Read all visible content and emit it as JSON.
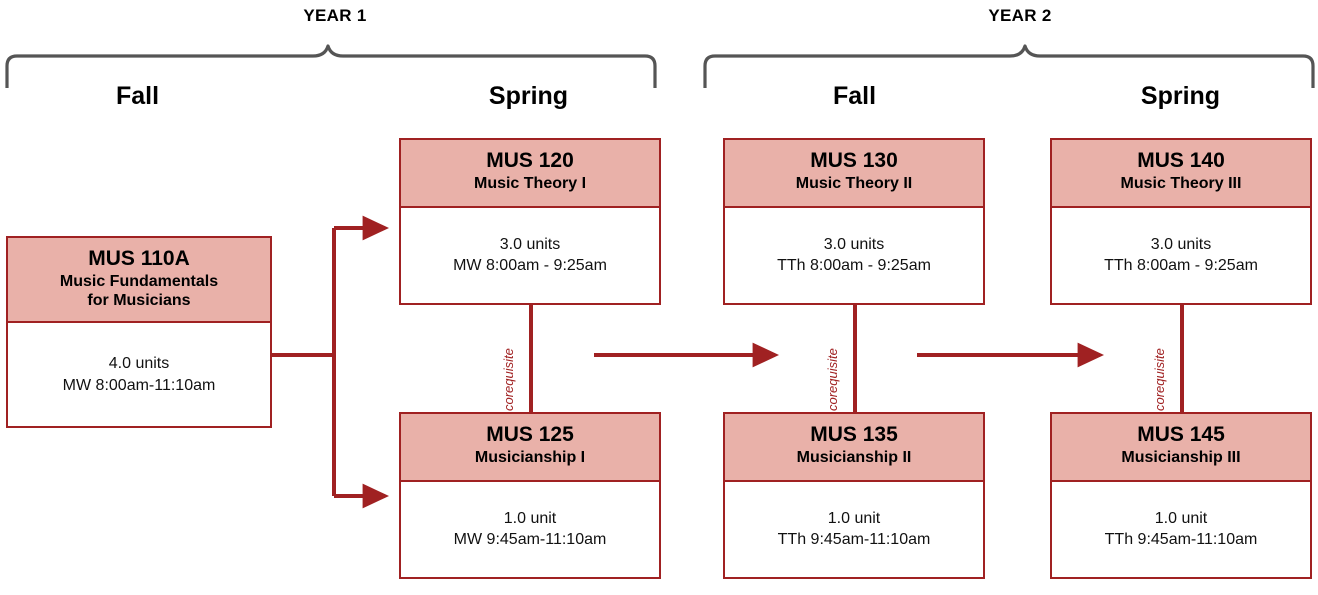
{
  "theme": {
    "box_fill": "#E9B1A9",
    "box_border": "#A02122",
    "arrow_color": "#A02122",
    "brace_color": "#555555",
    "text_color": "#000000",
    "background": "#FFFFFF"
  },
  "years": [
    {
      "label": "YEAR 1",
      "terms": [
        "Fall",
        "Spring"
      ]
    },
    {
      "label": "YEAR 2",
      "terms": [
        "Fall",
        "Spring"
      ]
    }
  ],
  "terms": [
    {
      "id": "y1-fall",
      "label": "Fall"
    },
    {
      "id": "y1-spring",
      "label": "Spring"
    },
    {
      "id": "y2-fall",
      "label": "Fall"
    },
    {
      "id": "y2-spring",
      "label": "Spring"
    }
  ],
  "courses": [
    {
      "id": "mus110a",
      "code": "MUS 110A",
      "title_line1": "Music Fundamentals",
      "title_line2": "for Musicians",
      "units": "4.0 units",
      "meeting": "MW 8:00am-11:10am"
    },
    {
      "id": "mus120",
      "code": "MUS 120",
      "title_line1": "Music Theory I",
      "title_line2": "",
      "units": "3.0 units",
      "meeting": "MW 8:00am - 9:25am"
    },
    {
      "id": "mus130",
      "code": "MUS 130",
      "title_line1": "Music Theory II",
      "title_line2": "",
      "units": "3.0 units",
      "meeting": "TTh 8:00am - 9:25am"
    },
    {
      "id": "mus140",
      "code": "MUS 140",
      "title_line1": "Music Theory III",
      "title_line2": "",
      "units": "3.0 units",
      "meeting": "TTh 8:00am - 9:25am"
    },
    {
      "id": "mus125",
      "code": "MUS 125",
      "title_line1": "Musicianship I",
      "title_line2": "",
      "units": "1.0 unit",
      "meeting": "MW 9:45am-11:10am"
    },
    {
      "id": "mus135",
      "code": "MUS 135",
      "title_line1": "Musicianship II",
      "title_line2": "",
      "units": "1.0 unit",
      "meeting": "TTh 9:45am-11:10am"
    },
    {
      "id": "mus145",
      "code": "MUS 145",
      "title_line1": "Musicianship III",
      "title_line2": "",
      "units": "1.0 unit",
      "meeting": "TTh 9:45am-11:10am"
    }
  ],
  "corequisite_links": [
    {
      "id": "coreq1",
      "label": "corequisite",
      "from": "mus120",
      "to": "mus125"
    },
    {
      "id": "coreq2",
      "label": "corequisite",
      "from": "mus130",
      "to": "mus135"
    },
    {
      "id": "coreq3",
      "label": "corequisite",
      "from": "mus140",
      "to": "mus145"
    }
  ],
  "prerequisite_flows": [
    {
      "from": "mus110a",
      "to": "mus120"
    },
    {
      "from": "mus110a",
      "to": "mus125"
    },
    {
      "from": "mus120",
      "to": "mus130"
    },
    {
      "from": "mus130",
      "to": "mus140"
    }
  ]
}
